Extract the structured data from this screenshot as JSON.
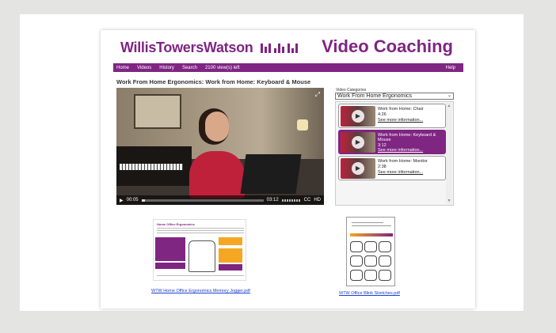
{
  "header": {
    "logo_text": "WillisTowersWatson",
    "app_title": "Video Coaching"
  },
  "nav": {
    "items": [
      "Home",
      "Videos",
      "History",
      "Search"
    ],
    "views_left": "2100 view(s) left",
    "help": "Help"
  },
  "video": {
    "title": "Work From Home Ergonomics: Work from Home: Keyboard & Mouse",
    "current_time": "00:05",
    "duration": "03:12",
    "progress_fraction": 0.03,
    "cc_label": "CC",
    "hd_label": "HD"
  },
  "categories": {
    "label": "Video Categories",
    "selected": "Work From Home Ergonomics"
  },
  "playlist": [
    {
      "title": "Work from Home: Chair",
      "duration": "4:26",
      "more": "See more information..."
    },
    {
      "title": "Work from Home: Keyboard & Mouse",
      "duration": "3:12",
      "more": "See more information..."
    },
    {
      "title": "Work from Home: Monitor",
      "duration": "2:38",
      "more": "See more information..."
    }
  ],
  "documents": {
    "doc1_link": "WTW Home Office Ergonomics Memory Jogger.pdf",
    "doc1_heading": "Home Office Ergonomics",
    "doc2_link": "WTW Office Blink Stretches.pdf"
  },
  "colors": {
    "brand_purple": "#7f2582",
    "accent_orange": "#f5a623",
    "link_blue": "#1a3fcc"
  }
}
